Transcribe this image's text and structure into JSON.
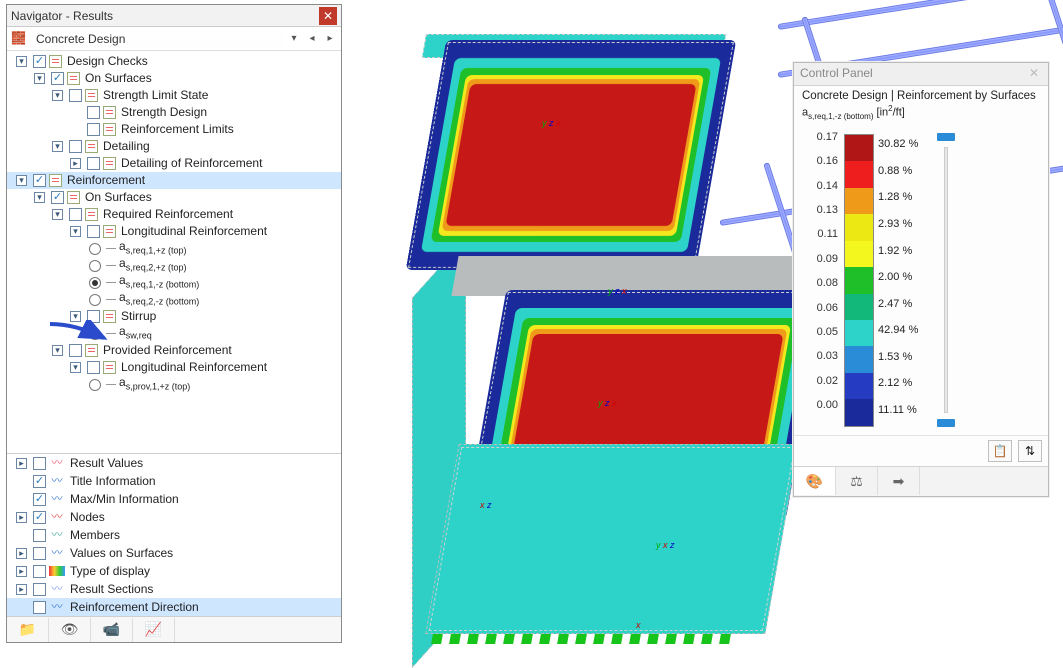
{
  "navigator": {
    "title": "Navigator - Results",
    "combo": "Concrete Design",
    "tree": [
      {
        "ind": 0,
        "tog": "▾",
        "ck": true,
        "ic": "doc",
        "label": "Design Checks"
      },
      {
        "ind": 1,
        "tog": "▾",
        "ck": true,
        "ic": "doc",
        "label": "On Surfaces"
      },
      {
        "ind": 2,
        "tog": "▾",
        "ck": false,
        "ic": "doc",
        "label": "Strength Limit State"
      },
      {
        "ind": 3,
        "tog": "",
        "ck": false,
        "ic": "doc",
        "label": "Strength Design"
      },
      {
        "ind": 3,
        "tog": "",
        "ck": false,
        "ic": "doc",
        "label": "Reinforcement Limits"
      },
      {
        "ind": 2,
        "tog": "▾",
        "ck": false,
        "ic": "doc",
        "label": "Detailing"
      },
      {
        "ind": 3,
        "tog": "▸",
        "ck": false,
        "ic": "doc",
        "label": "Detailing of Reinforcement"
      },
      {
        "ind": 0,
        "tog": "▾",
        "ck": true,
        "ic": "doc",
        "label": "Reinforcement",
        "sel": true
      },
      {
        "ind": 1,
        "tog": "▾",
        "ck": true,
        "ic": "doc",
        "label": "On Surfaces"
      },
      {
        "ind": 2,
        "tog": "▾",
        "ck": false,
        "ic": "doc",
        "label": "Required Reinforcement"
      },
      {
        "ind": 3,
        "tog": "▾",
        "ck": false,
        "ic": "doc",
        "label": "Longitudinal Reinforcement"
      },
      {
        "ind": 4,
        "rad": false,
        "label": "a_{s,req,1,+z (top)}"
      },
      {
        "ind": 4,
        "rad": false,
        "label": "a_{s,req,2,+z (top)}"
      },
      {
        "ind": 4,
        "rad": true,
        "label": "a_{s,req,1,-z (bottom)}"
      },
      {
        "ind": 4,
        "rad": false,
        "label": "a_{s,req,2,-z (bottom)}"
      },
      {
        "ind": 3,
        "tog": "▾",
        "ck": false,
        "ic": "doc",
        "label": "Stirrup"
      },
      {
        "ind": 4,
        "rad": false,
        "label": "a_{sw,req}"
      },
      {
        "ind": 2,
        "tog": "▾",
        "ck": false,
        "ic": "doc",
        "label": "Provided Reinforcement"
      },
      {
        "ind": 3,
        "tog": "▾",
        "ck": false,
        "ic": "doc",
        "label": "Longitudinal Reinforcement"
      },
      {
        "ind": 4,
        "rad": false,
        "label": "a_{s,prov,1,+z (top)}"
      }
    ],
    "sections": [
      {
        "tog": "▸",
        "ck": false,
        "label": "Result Values",
        "color": "#e57"
      },
      {
        "tog": "",
        "ck": true,
        "label": "Title Information",
        "color": "#37c"
      },
      {
        "tog": "",
        "ck": true,
        "label": "Max/Min Information",
        "color": "#37c"
      },
      {
        "tog": "▸",
        "ck": true,
        "label": "Nodes",
        "color": "#d44"
      },
      {
        "tog": "",
        "ck": false,
        "label": "Members",
        "color": "#4a9"
      },
      {
        "tog": "▸",
        "ck": false,
        "label": "Values on Surfaces",
        "color": "#37c"
      },
      {
        "tog": "▸",
        "ck": false,
        "label": "Type of display",
        "color": "rainbow"
      },
      {
        "tog": "▸",
        "ck": false,
        "label": "Result Sections",
        "color": "#79e"
      },
      {
        "tog": "",
        "ck": false,
        "label": "Reinforcement Direction",
        "color": "#37c",
        "sel": true
      }
    ],
    "bottomTabs": [
      "📁",
      "👁",
      "📹",
      "📈"
    ]
  },
  "controlPanel": {
    "title": "Control Panel",
    "heading": "Concrete Design | Reinforcement by Surfaces",
    "subscript": "a_{s,req,1,-z (bottom)} [in²/ft]",
    "ticks": [
      "0.17",
      "0.16",
      "0.14",
      "0.13",
      "0.11",
      "0.09",
      "0.08",
      "0.06",
      "0.05",
      "0.03",
      "0.02",
      "0.00"
    ],
    "colors": [
      "#b01616",
      "#ef1e1e",
      "#f09a1a",
      "#ece813",
      "#f3f71e",
      "#1fbf2a",
      "#12b77a",
      "#2dd3c9",
      "#2a8bd6",
      "#253cc2",
      "#1a2a9a"
    ],
    "percents": [
      "30.82 %",
      "0.88 %",
      "1.28 %",
      "2.93 %",
      "1.92 %",
      "2.00 %",
      "2.47 %",
      "42.94 %",
      "1.53 %",
      "2.12 %",
      "11.11 %"
    ],
    "footerBtns": [
      "📋",
      "⇅"
    ],
    "tabs": [
      "🎨",
      "⚖",
      "➡"
    ]
  },
  "chart_data": {
    "type": "table",
    "title": "Concrete Design | Reinforcement by Surfaces — a_s,req,1,-z (bottom) [in²/ft]",
    "legend_bins": [
      {
        "upper": 0.17,
        "lower": 0.16,
        "color": "#b01616",
        "percent": 30.82
      },
      {
        "upper": 0.16,
        "lower": 0.14,
        "color": "#ef1e1e",
        "percent": 0.88
      },
      {
        "upper": 0.14,
        "lower": 0.13,
        "color": "#f09a1a",
        "percent": 1.28
      },
      {
        "upper": 0.13,
        "lower": 0.11,
        "color": "#ece813",
        "percent": 2.93
      },
      {
        "upper": 0.11,
        "lower": 0.09,
        "color": "#f3f71e",
        "percent": 1.92
      },
      {
        "upper": 0.09,
        "lower": 0.08,
        "color": "#1fbf2a",
        "percent": 2.0
      },
      {
        "upper": 0.08,
        "lower": 0.06,
        "color": "#12b77a",
        "percent": 2.47
      },
      {
        "upper": 0.06,
        "lower": 0.05,
        "color": "#2dd3c9",
        "percent": 42.94
      },
      {
        "upper": 0.05,
        "lower": 0.03,
        "color": "#2a8bd6",
        "percent": 1.53
      },
      {
        "upper": 0.03,
        "lower": 0.02,
        "color": "#253cc2",
        "percent": 2.12
      },
      {
        "upper": 0.02,
        "lower": 0.0,
        "color": "#1a2a9a",
        "percent": 11.11
      }
    ],
    "unit": "in²/ft"
  }
}
